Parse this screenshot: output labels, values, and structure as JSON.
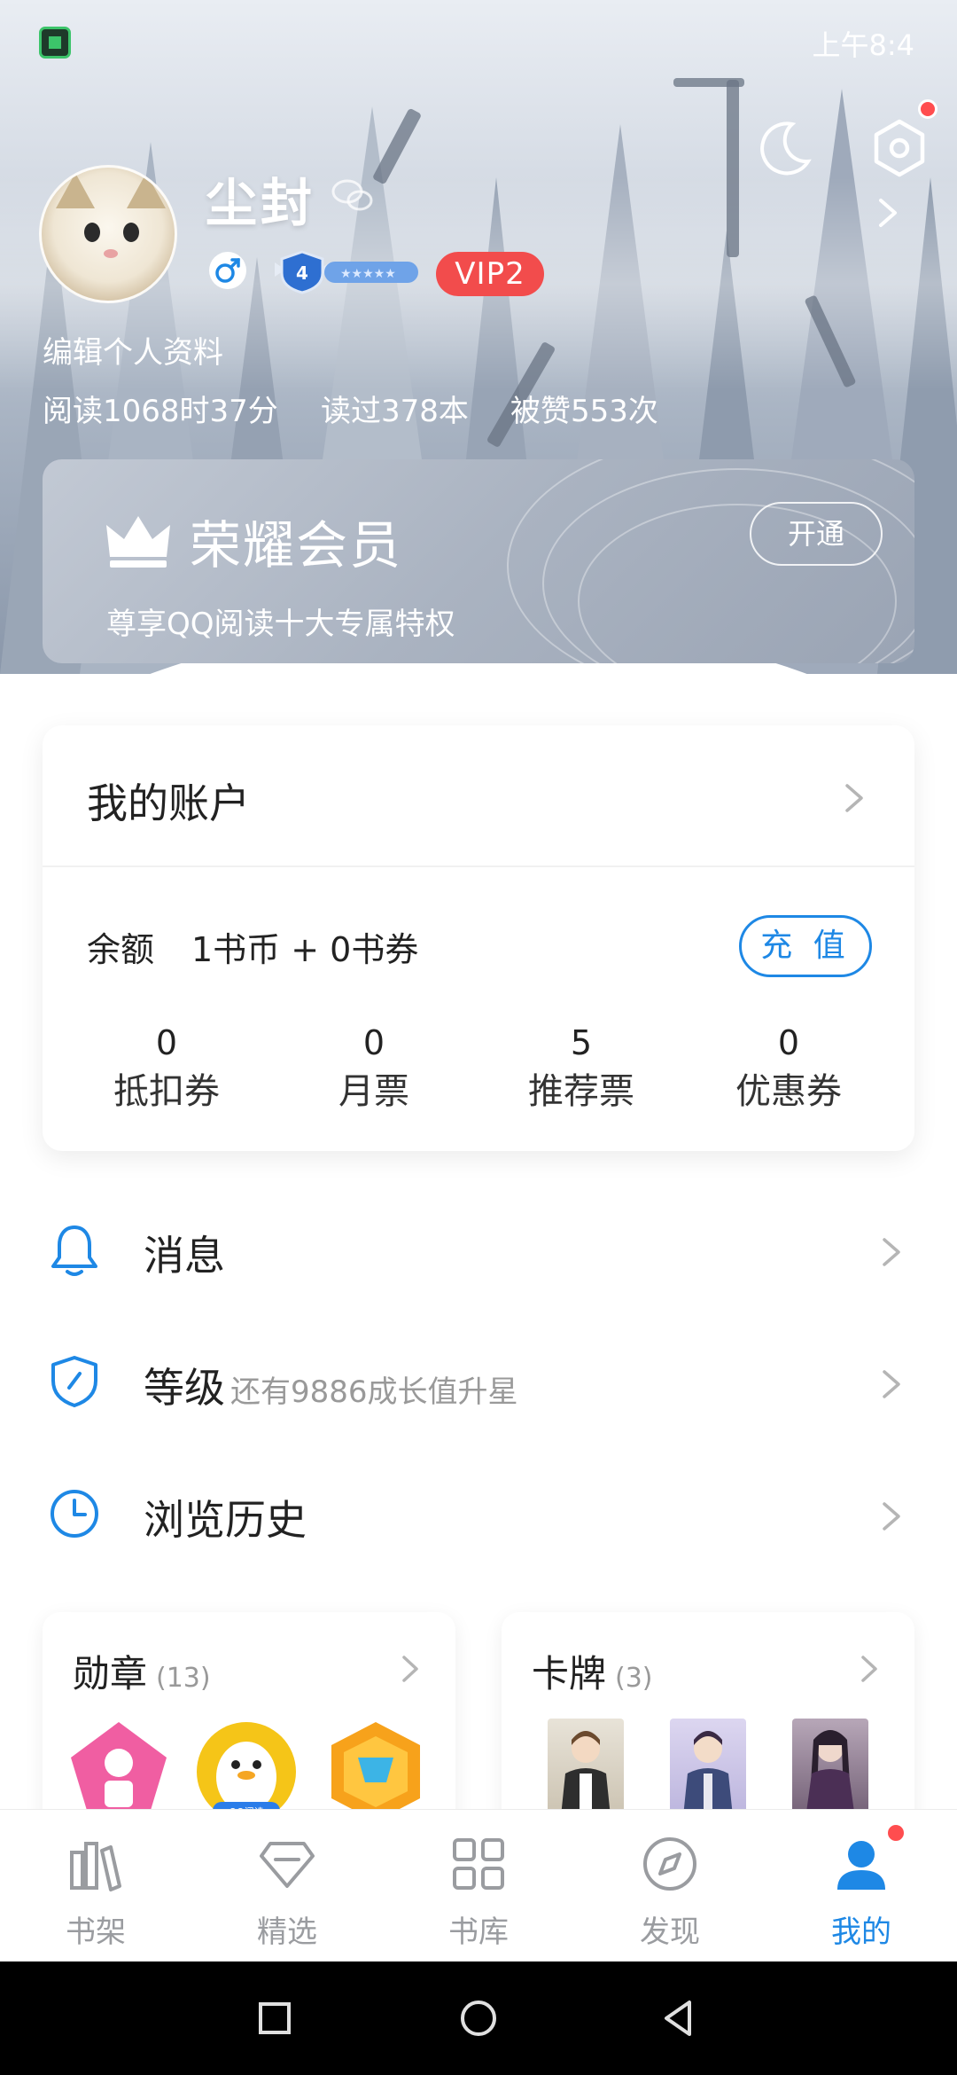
{
  "status_bar": {
    "time": "上午8:4"
  },
  "profile": {
    "username": "尘封",
    "vip_badge": "VIP2",
    "level_number": "4",
    "edit_profile": "编辑个人资料",
    "stats": {
      "read_time": "阅读1068时37分",
      "books_read": "读过378本",
      "likes": "被赞553次"
    }
  },
  "honor": {
    "title": "荣耀会员",
    "subtitle": "尊享QQ阅读十大专属特权",
    "open_button": "开通"
  },
  "account": {
    "title": "我的账户",
    "balance_label": "余额",
    "balance_value": "1书币 + 0书券",
    "recharge_button": "充 值",
    "tickets": [
      {
        "count": "0",
        "label": "抵扣券"
      },
      {
        "count": "0",
        "label": "月票"
      },
      {
        "count": "5",
        "label": "推荐票"
      },
      {
        "count": "0",
        "label": "优惠券"
      }
    ]
  },
  "menu": {
    "messages": {
      "label": "消息"
    },
    "level": {
      "label": "等级",
      "sub": "还有9886成长值升星"
    },
    "history": {
      "label": "浏览历史"
    }
  },
  "medals": {
    "title": "勋章",
    "count": "(13)",
    "penguin_text": "QQ阅读"
  },
  "cards": {
    "title": "卡牌",
    "count": "(3)"
  },
  "bottom_nav": {
    "items": [
      {
        "label": "书架",
        "icon": "bookshelf-icon"
      },
      {
        "label": "精选",
        "icon": "diamond-icon"
      },
      {
        "label": "书库",
        "icon": "grid-icon"
      },
      {
        "label": "发现",
        "icon": "compass-icon"
      },
      {
        "label": "我的",
        "icon": "person-icon"
      }
    ],
    "active": "我的",
    "active_color": "#1e88e5"
  },
  "colors": {
    "accent": "#1e88e5",
    "vip_red": "#f24c4c",
    "notification": "#ff4d4f"
  }
}
